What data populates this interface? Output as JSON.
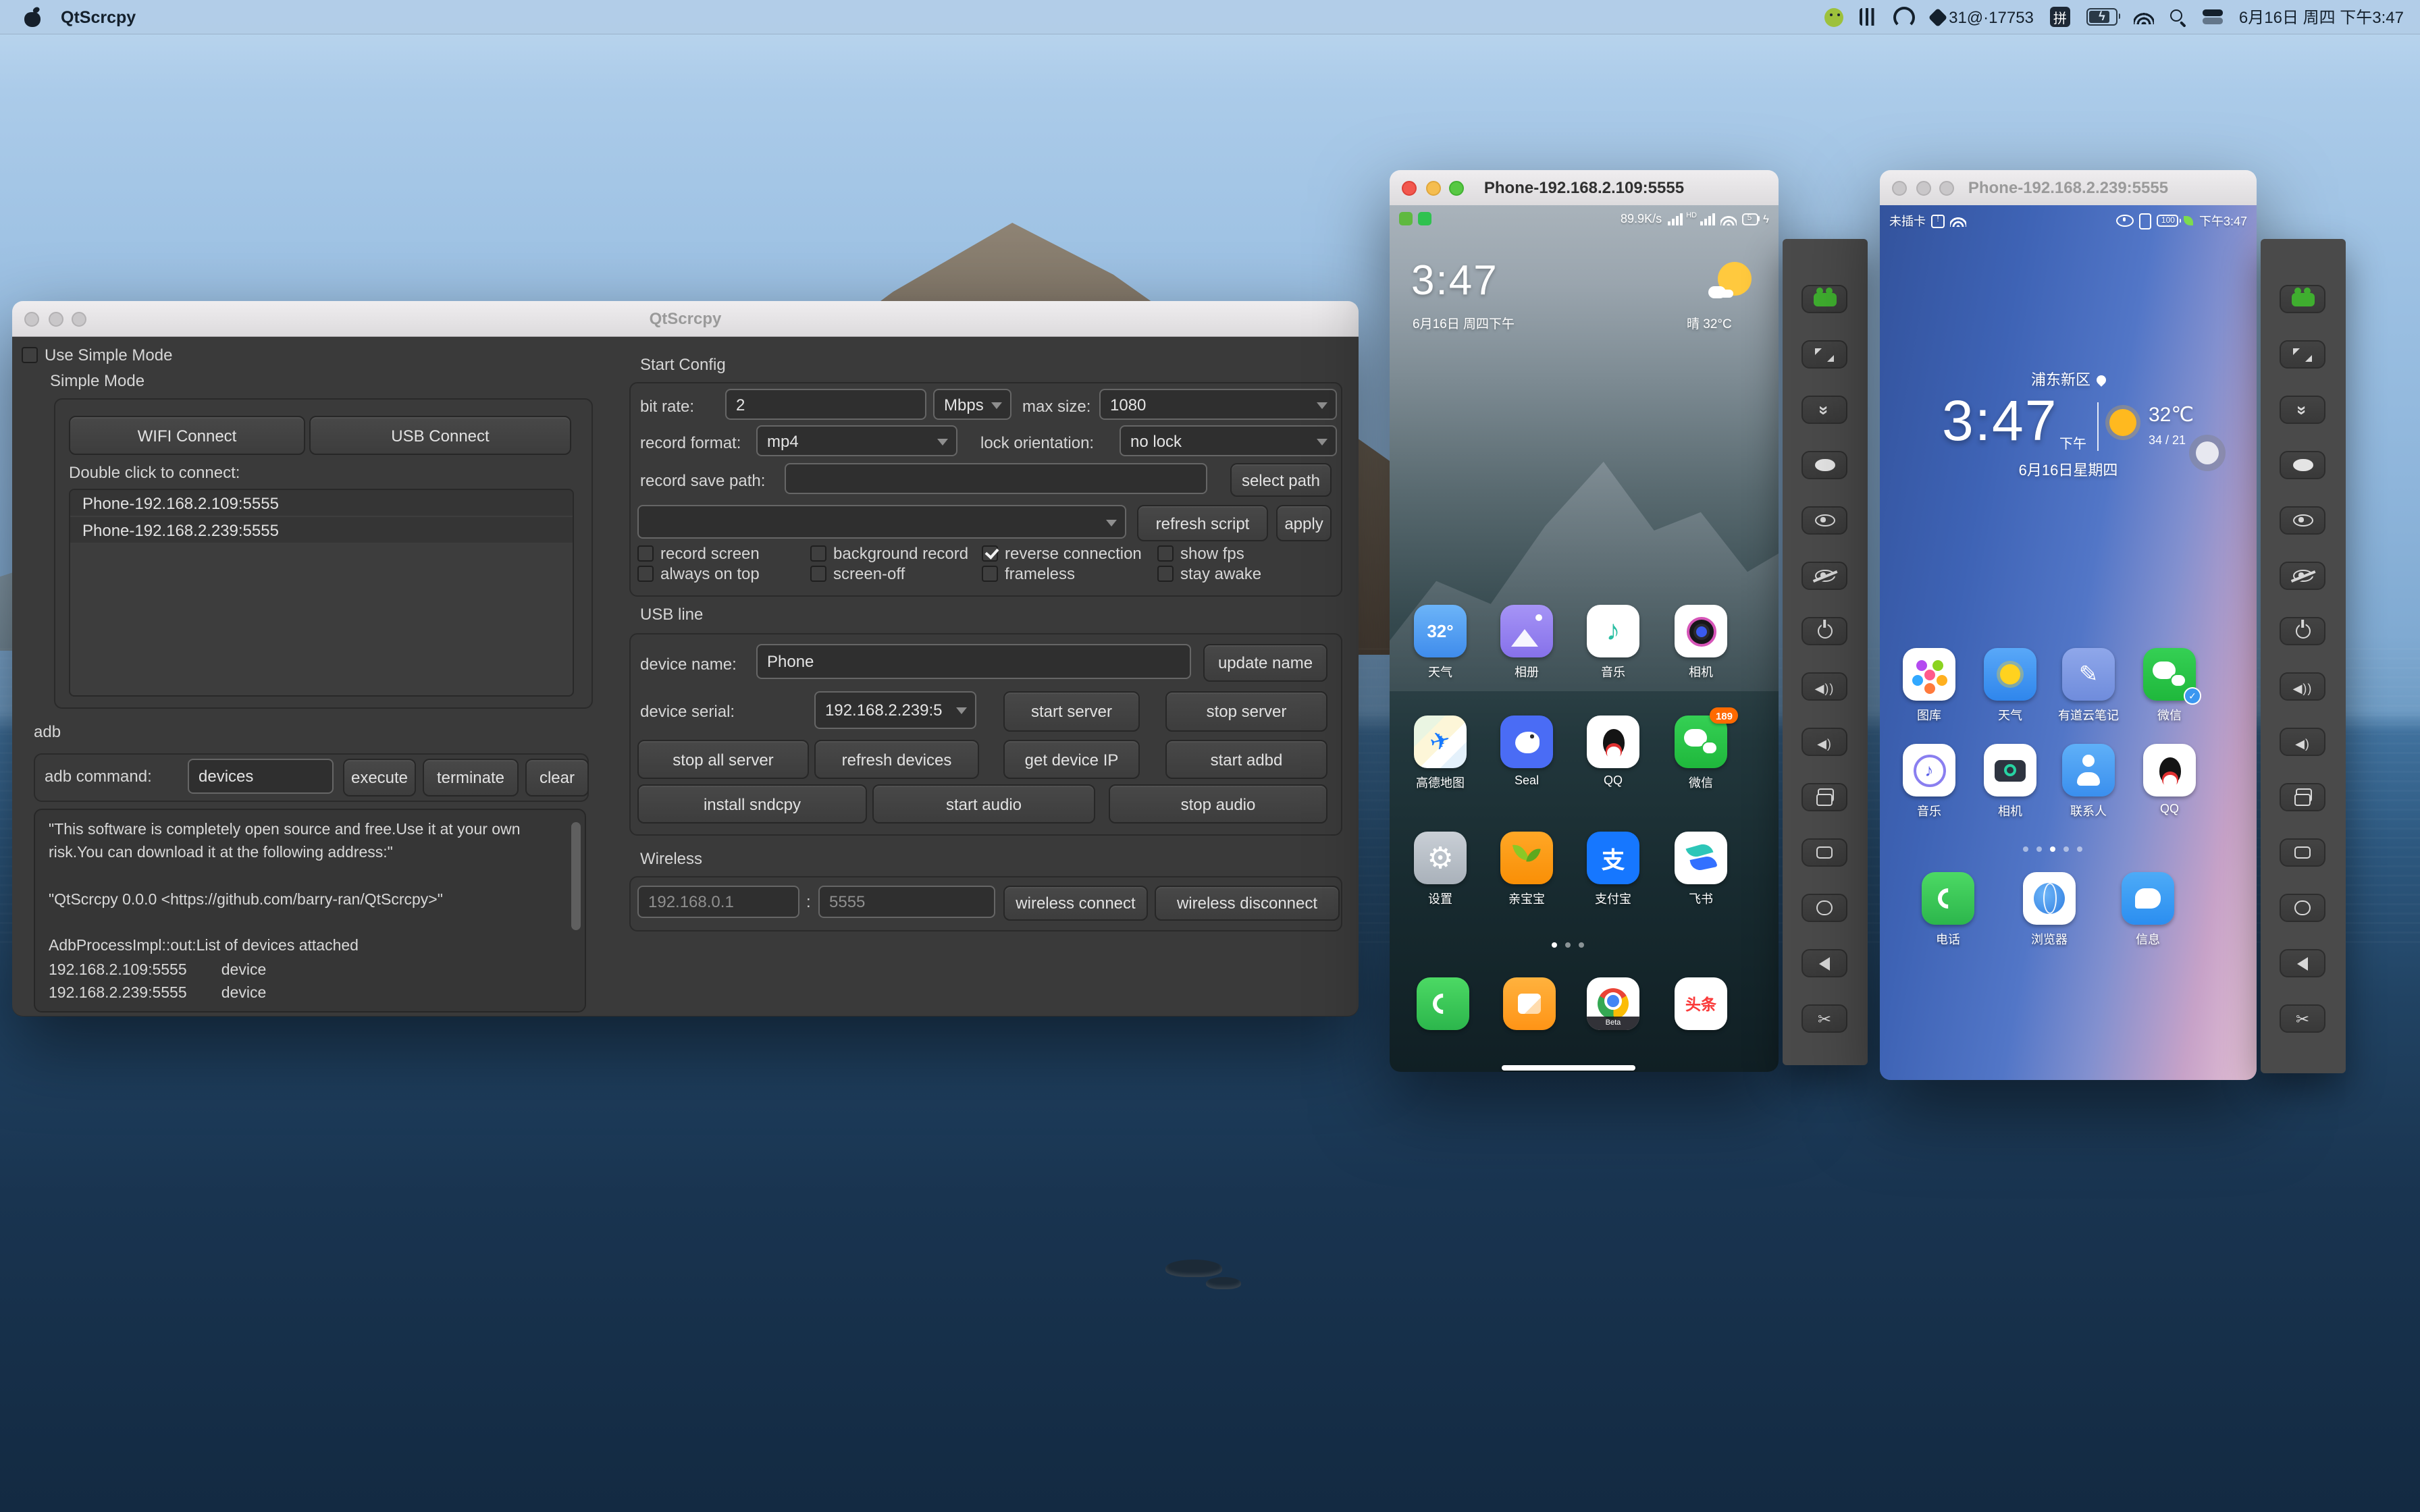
{
  "menu_bar": {
    "app_name": "QtScrcpy",
    "status_text": "31@·17753",
    "ime_label": "拼",
    "clock": "6月16日 周四 下午3:47"
  },
  "main_window": {
    "title": "QtScrcpy",
    "use_simple_mode_label": "Use Simple Mode",
    "simple_mode_label": "Simple Mode",
    "wifi_connect_label": "WIFI Connect",
    "usb_connect_label": "USB Connect",
    "double_click_label": "Double click to connect:",
    "device_list": [
      "Phone-192.168.2.109:5555",
      "Phone-192.168.2.239:5555"
    ],
    "adb": {
      "group_label": "adb",
      "command_label": "adb command:",
      "command_value": "devices",
      "execute_label": "execute",
      "terminate_label": "terminate",
      "clear_label": "clear",
      "log": "\"This software is completely open source and free.Use it at your own risk.You can download it at the following address:\"\n\n\"QtScrcpy 0.0.0 <https://github.com/barry-ran/QtScrcpy>\"\n\nAdbProcessImpl::out:List of devices attached\n192.168.2.109:5555        device\n192.168.2.239:5555        device"
    },
    "start_config": {
      "section_label": "Start Config",
      "bit_rate_label": "bit rate:",
      "bit_rate_value": "2",
      "bit_rate_unit": "Mbps",
      "max_size_label": "max size:",
      "max_size_value": "1080",
      "record_format_label": "record format:",
      "record_format_value": "mp4",
      "lock_orientation_label": "lock orientation:",
      "lock_orientation_value": "no lock",
      "record_save_path_label": "record save path:",
      "select_path_label": "select path",
      "refresh_script_label": "refresh script",
      "apply_label": "apply",
      "checkboxes": {
        "record_screen": "record screen",
        "background_record": "background record",
        "reverse_connection": "reverse connection",
        "show_fps": "show fps",
        "always_on_top": "always on top",
        "screen_off": "screen-off",
        "frameless": "frameless",
        "stay_awake": "stay awake"
      }
    },
    "usb_line": {
      "section_label": "USB line",
      "device_name_label": "device name:",
      "device_name_value": "Phone",
      "update_name_label": "update name",
      "device_serial_label": "device serial:",
      "device_serial_value": "192.168.2.239:5",
      "start_server_label": "start server",
      "stop_server_label": "stop server",
      "stop_all_server_label": "stop all server",
      "refresh_devices_label": "refresh devices",
      "get_device_ip_label": "get device IP",
      "start_adbd_label": "start adbd",
      "install_sndcpy_label": "install sndcpy",
      "start_audio_label": "start audio",
      "stop_audio_label": "stop audio"
    },
    "wireless": {
      "section_label": "Wireless",
      "ip_value": "192.168.0.1",
      "separator": ":",
      "port_value": "5555",
      "connect_label": "wireless connect",
      "disconnect_label": "wireless disconnect"
    }
  },
  "phone1": {
    "title": "Phone-192.168.2.109:5555",
    "status": {
      "speed": "89.9K/s",
      "hd": "HD",
      "battery": "5"
    },
    "clock": "3:47",
    "date": "6月16日 周四下午",
    "weather": "晴 32°C",
    "apps": [
      {
        "label": "天气",
        "glyph": "32°"
      },
      {
        "label": "相册"
      },
      {
        "label": "音乐"
      },
      {
        "label": "相机"
      },
      {
        "label": "高德地图"
      },
      {
        "label": "Seal"
      },
      {
        "label": "QQ"
      },
      {
        "label": "微信",
        "badge": "189"
      },
      {
        "label": "设置"
      },
      {
        "label": "亲宝宝"
      },
      {
        "label": "支付宝",
        "glyph": "支"
      },
      {
        "label": "飞书"
      }
    ],
    "dock": [
      {
        "name": "phone"
      },
      {
        "name": "messages"
      },
      {
        "name": "chrome-beta",
        "sub": "Beta"
      },
      {
        "name": "toutiao",
        "glyph": "头条"
      }
    ]
  },
  "phone2": {
    "title": "Phone-192.168.2.239:5555",
    "status": {
      "sim": "未插卡",
      "battery": "100",
      "time": "下午3:47"
    },
    "location": "浦东新区",
    "clock": "3:47",
    "ampm": "下午",
    "temp": "32℃",
    "hilo": "34 / 21",
    "date": "6月16日星期四",
    "apps": [
      {
        "label": "图库"
      },
      {
        "label": "天气"
      },
      {
        "label": "有道云笔记"
      },
      {
        "label": "微信"
      },
      {
        "label": "音乐"
      },
      {
        "label": "相机"
      },
      {
        "label": "联系人"
      },
      {
        "label": "QQ"
      }
    ],
    "dock": [
      {
        "label": "电话"
      },
      {
        "label": "浏览器"
      },
      {
        "label": "信息"
      }
    ]
  },
  "toolbar": {
    "icons": [
      "group",
      "fullscreen",
      "collapse",
      "screenshot",
      "screen-on",
      "screen-off",
      "power",
      "volume-up",
      "volume-down",
      "app-switch",
      "menu",
      "home",
      "back",
      "cut-screenshot"
    ]
  }
}
